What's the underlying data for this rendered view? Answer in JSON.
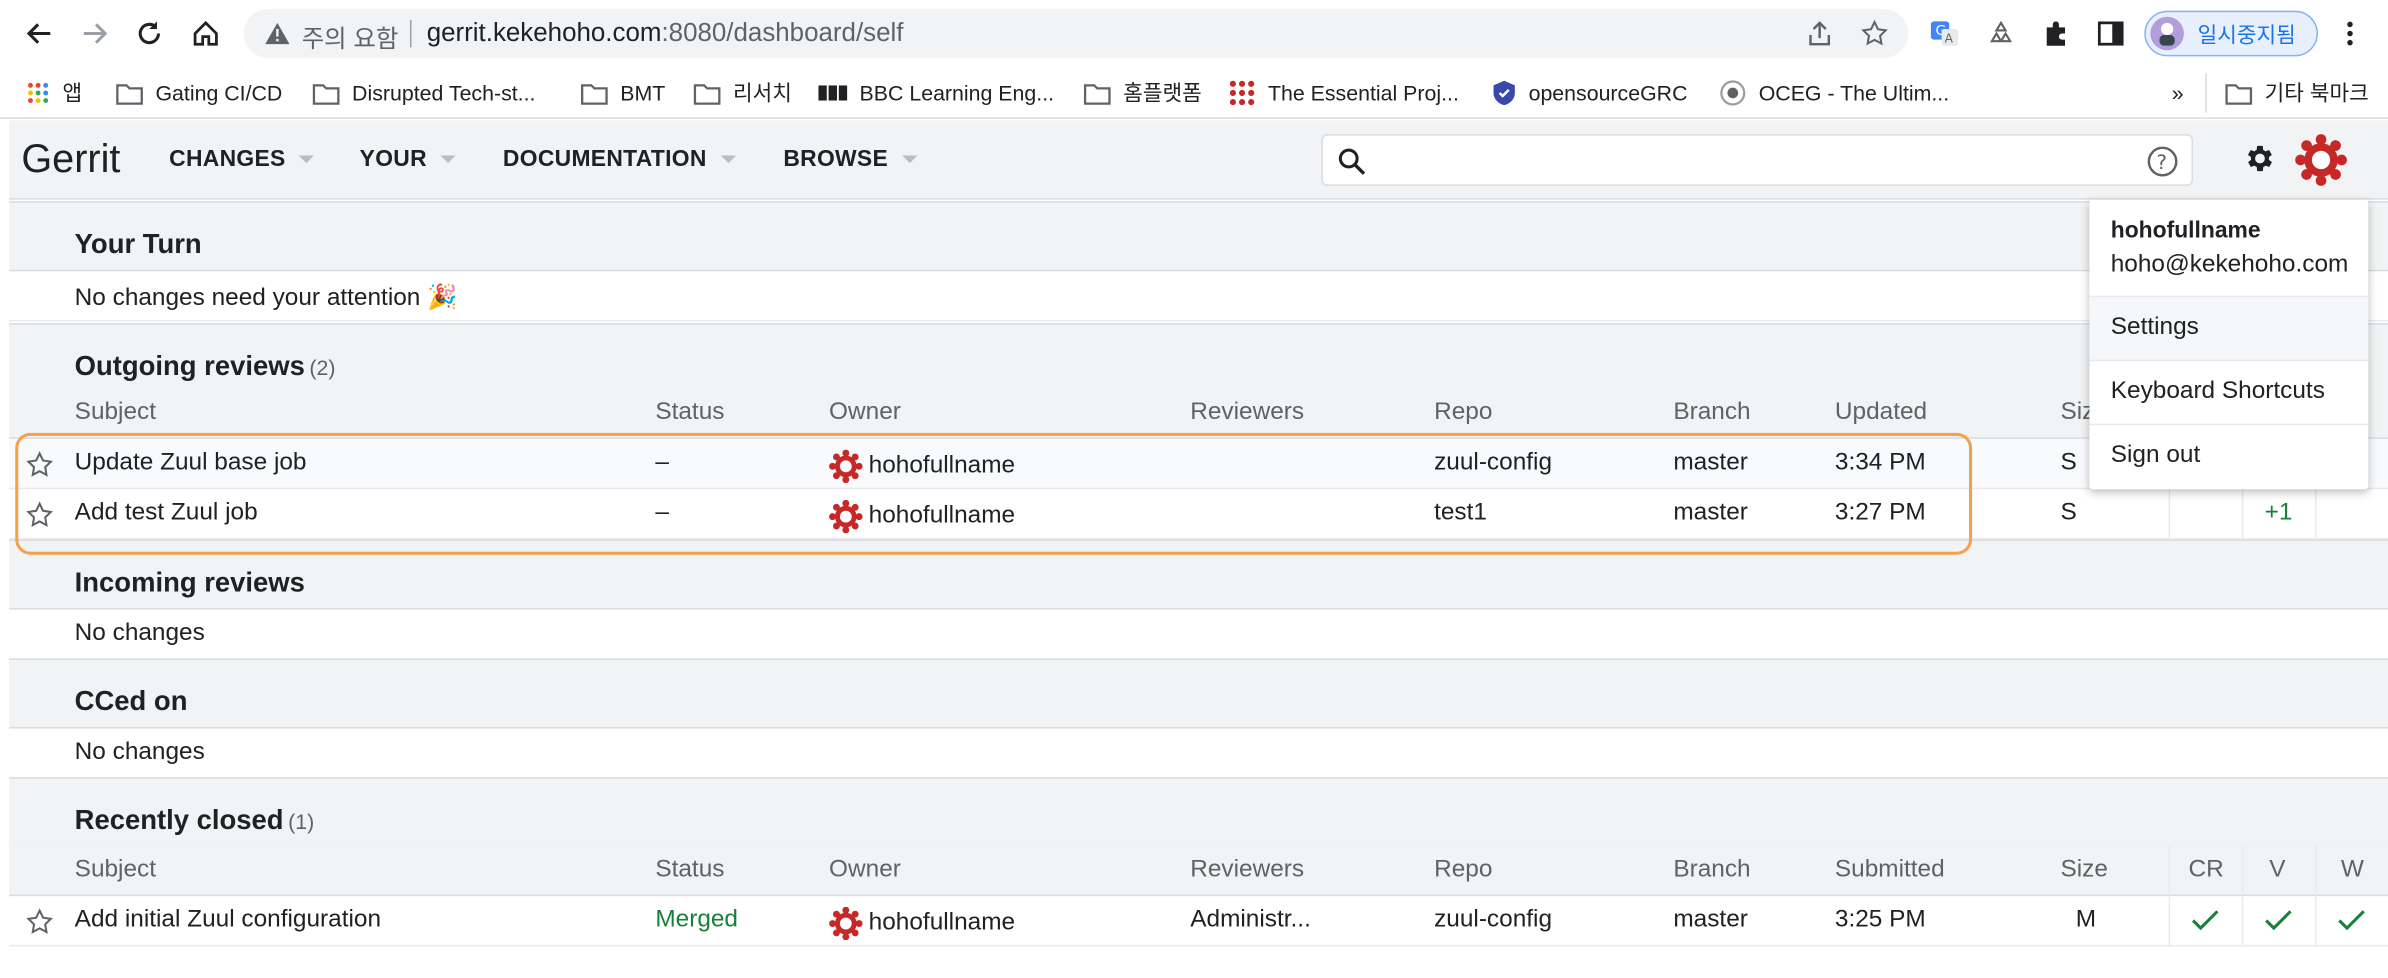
{
  "browser": {
    "omnibox": {
      "warning": "주의 요함",
      "url_host": "gerrit.kekehoho.com",
      "url_rest": ":8080/dashboard/self"
    },
    "profile_label": "일시중지됨",
    "bookmarks": [
      {
        "label": "앱",
        "icon": "apps-grid-icon"
      },
      {
        "label": "Gating CI/CD",
        "icon": "folder-icon"
      },
      {
        "label": "Disrupted Tech-st...",
        "icon": "folder-icon"
      },
      {
        "label": "BMT",
        "icon": "folder-icon"
      },
      {
        "label": "리서치",
        "icon": "folder-icon"
      },
      {
        "label": "BBC Learning Eng...",
        "icon": "bbc-icon"
      },
      {
        "label": "홈플랫폼",
        "icon": "folder-icon"
      },
      {
        "label": "The Essential Proj...",
        "icon": "dots-grid-icon"
      },
      {
        "label": "opensourceGRC",
        "icon": "shield-icon"
      },
      {
        "label": "OCEG - The Ultim...",
        "icon": "circle-icon"
      }
    ],
    "bookmarks_overflow": "»",
    "other_bookmarks": "기타 북마크"
  },
  "gerrit": {
    "logo": "Gerrit",
    "nav": [
      "CHANGES",
      "YOUR",
      "DOCUMENTATION",
      "BROWSE"
    ],
    "search_placeholder": ""
  },
  "dashboard": {
    "your_turn": {
      "title": "Your Turn",
      "empty": "No changes need your attention 🎉"
    },
    "outgoing": {
      "title": "Outgoing reviews",
      "count": "(2)",
      "columns": [
        "Subject",
        "Status",
        "Owner",
        "Reviewers",
        "Repo",
        "Branch",
        "Updated",
        "Size"
      ],
      "rows": [
        {
          "subject": "Update Zuul base job",
          "status": "–",
          "owner": "hohofullname",
          "reviewers": "",
          "repo": "zuul-config",
          "branch": "master",
          "updated": "3:34 PM",
          "size": "S",
          "v": ""
        },
        {
          "subject": "Add test Zuul job",
          "status": "–",
          "owner": "hohofullname",
          "reviewers": "",
          "repo": "test1",
          "branch": "master",
          "updated": "3:27 PM",
          "size": "S",
          "v": "+1"
        }
      ]
    },
    "incoming": {
      "title": "Incoming reviews",
      "empty": "No changes"
    },
    "cced": {
      "title": "CCed on",
      "empty": "No changes"
    },
    "closed": {
      "title": "Recently closed",
      "count": "(1)",
      "columns": [
        "Subject",
        "Status",
        "Owner",
        "Reviewers",
        "Repo",
        "Branch",
        "Submitted",
        "Size",
        "CR",
        "V",
        "W"
      ],
      "rows": [
        {
          "subject": "Add initial Zuul configuration",
          "status": "Merged",
          "owner": "hohofullname",
          "reviewers": "Administr...",
          "repo": "zuul-config",
          "branch": "master",
          "submitted": "3:25 PM",
          "size": "M"
        }
      ]
    }
  },
  "account_menu": {
    "name": "hohofullname",
    "email": "hoho@kekehoho.com",
    "items": [
      "Settings",
      "Keyboard Shortcuts",
      "Sign out"
    ]
  },
  "colors": {
    "merged": "#188038",
    "highlight": "#f5a04a",
    "avatar": "#c62828"
  }
}
